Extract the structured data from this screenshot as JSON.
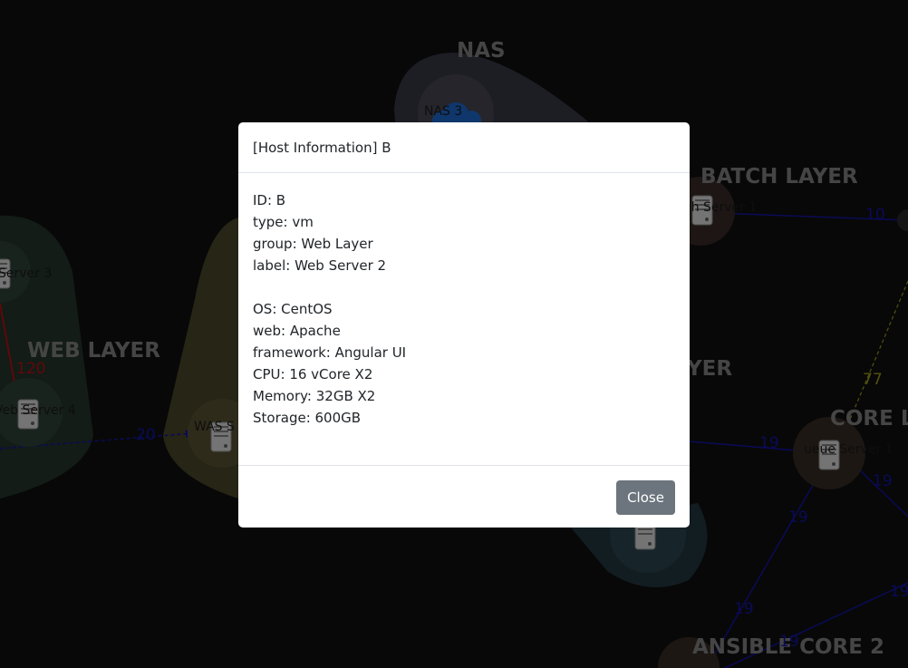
{
  "graph": {
    "groups": {
      "nas": "NAS",
      "batch": "BATCH LAYER",
      "web": "WEB LAYER",
      "was_partial": "YER",
      "core_partial": "CORE LA",
      "ansible": "ANSIBLE CORE 2"
    },
    "nodes": {
      "nas3": "NAS 3",
      "batch1_partial": "ch Server 1",
      "web3_partial": "Server 3",
      "web4_partial": "Veb Server 4",
      "was_partial": "WAS S",
      "queue1_partial": "ueue Server 1"
    },
    "edges": {
      "e120": "120",
      "e20": "20",
      "e10": "10",
      "e77": "77",
      "e19a": "19",
      "e19b": "19",
      "e19c": "19",
      "e19d": "19",
      "e19e": "19",
      "e19f": "19"
    },
    "colors": {
      "background": "#111111",
      "nas_group": "#3a3a48",
      "web_group": "#26382f",
      "was_group": "#4f4a2a",
      "teal_group": "#243b44",
      "edge_blue": "#1515b0",
      "edge_red": "#c01010",
      "edge_yellow": "#a8a020"
    }
  },
  "modal": {
    "title": "[Host Information] B",
    "fields": [
      "ID: B",
      "type: vm",
      "group: Web Layer",
      "label: Web Server 2"
    ],
    "specs": [
      "OS: CentOS",
      "web: Apache",
      "framework: Angular UI",
      "CPU: 16 vCore X2",
      "Memory: 32GB X2",
      "Storage: 600GB"
    ],
    "close_label": "Close"
  }
}
